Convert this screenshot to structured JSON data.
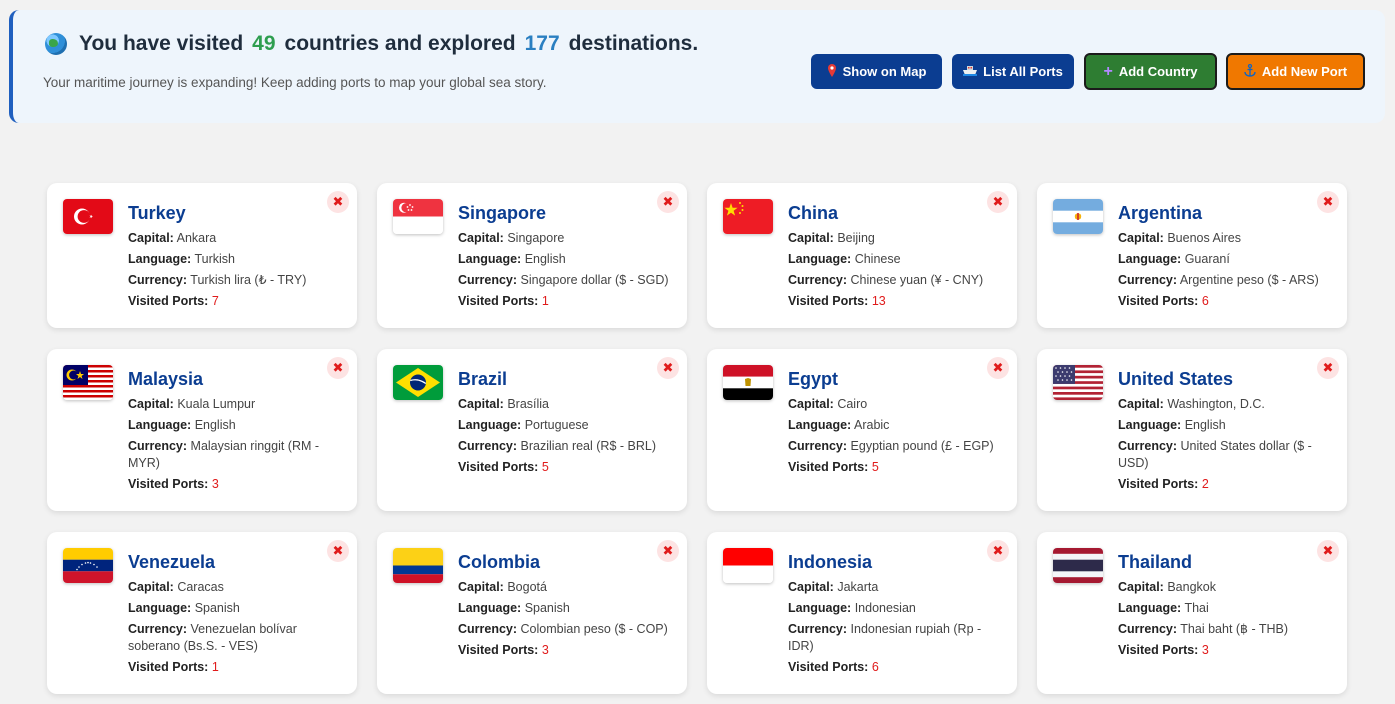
{
  "banner": {
    "prefix": "You have visited",
    "countries": "49",
    "middle": "countries and explored",
    "destinations": "177",
    "suffix": "destinations.",
    "subtitle": "Your maritime journey is expanding! Keep adding ports to map your global sea story."
  },
  "buttons": {
    "show_map": "Show on Map",
    "list_ports": "List All Ports",
    "add_country": "Add Country",
    "add_port": "Add New Port"
  },
  "labels": {
    "capital": "Capital:",
    "language": "Language:",
    "currency": "Currency:",
    "ports": "Visited Ports:",
    "close": "✖"
  },
  "countries": [
    {
      "name": "Turkey",
      "capital": "Ankara",
      "language": "Turkish",
      "currency": "Turkish lira (₺ - TRY)",
      "ports": "7"
    },
    {
      "name": "Singapore",
      "capital": "Singapore",
      "language": "English",
      "currency": "Singapore dollar ($ - SGD)",
      "ports": "1"
    },
    {
      "name": "China",
      "capital": "Beijing",
      "language": "Chinese",
      "currency": "Chinese yuan (¥ - CNY)",
      "ports": "13"
    },
    {
      "name": "Argentina",
      "capital": "Buenos Aires",
      "language": "Guaraní",
      "currency": "Argentine peso ($ - ARS)",
      "ports": "6"
    },
    {
      "name": "Malaysia",
      "capital": "Kuala Lumpur",
      "language": "English",
      "currency": "Malaysian ringgit (RM - MYR)",
      "ports": "3"
    },
    {
      "name": "Brazil",
      "capital": "Brasília",
      "language": "Portuguese",
      "currency": "Brazilian real (R$ - BRL)",
      "ports": "5"
    },
    {
      "name": "Egypt",
      "capital": "Cairo",
      "language": "Arabic",
      "currency": "Egyptian pound (£ - EGP)",
      "ports": "5"
    },
    {
      "name": "United States",
      "capital": "Washington, D.C.",
      "language": "English",
      "currency": "United States dollar ($ - USD)",
      "ports": "2"
    },
    {
      "name": "Venezuela",
      "capital": "Caracas",
      "language": "Spanish",
      "currency": "Venezuelan bolívar soberano (Bs.S. - VES)",
      "ports": "1"
    },
    {
      "name": "Colombia",
      "capital": "Bogotá",
      "language": "Spanish",
      "currency": "Colombian peso ($ - COP)",
      "ports": "3"
    },
    {
      "name": "Indonesia",
      "capital": "Jakarta",
      "language": "Indonesian",
      "currency": "Indonesian rupiah (Rp - IDR)",
      "ports": "6"
    },
    {
      "name": "Thailand",
      "capital": "Bangkok",
      "language": "Thai",
      "currency": "Thai baht (฿ - THB)",
      "ports": "3"
    }
  ]
}
